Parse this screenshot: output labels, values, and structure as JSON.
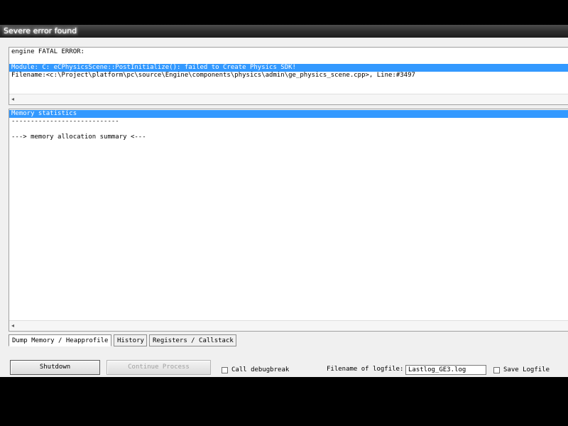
{
  "window": {
    "title": "Severe error found"
  },
  "error_panel": {
    "lines": [
      "engine FATAL ERROR:",
      "",
      "Module: C: eCPhysicsScene::PostInitialize(): failed to Create Physics SDK!",
      "Filename:<c:\\Project\\platform\\pc\\source\\Engine\\components\\physics\\admin\\ge_physics_scene.cpp>, Line:#3497"
    ],
    "scroll_left_arrow": "◂"
  },
  "memory_panel": {
    "lines": [
      "Memory statistics",
      "----------------------------",
      "",
      "---> memory allocation summary <---"
    ],
    "scroll_left_arrow": "◂"
  },
  "tabs": [
    {
      "label": "Dump Memory / Heapprofile"
    },
    {
      "label": "History"
    },
    {
      "label": "Registers / Callstack"
    }
  ],
  "actions": {
    "shutdown": "Shutdown",
    "continue": "Continue Process",
    "call_debugbreak": "Call debugbreak",
    "logfile_label": "Filename of logfile:",
    "logfile_value": "Lastlog_GE3.log",
    "save_logfile": "Save Logfile"
  }
}
